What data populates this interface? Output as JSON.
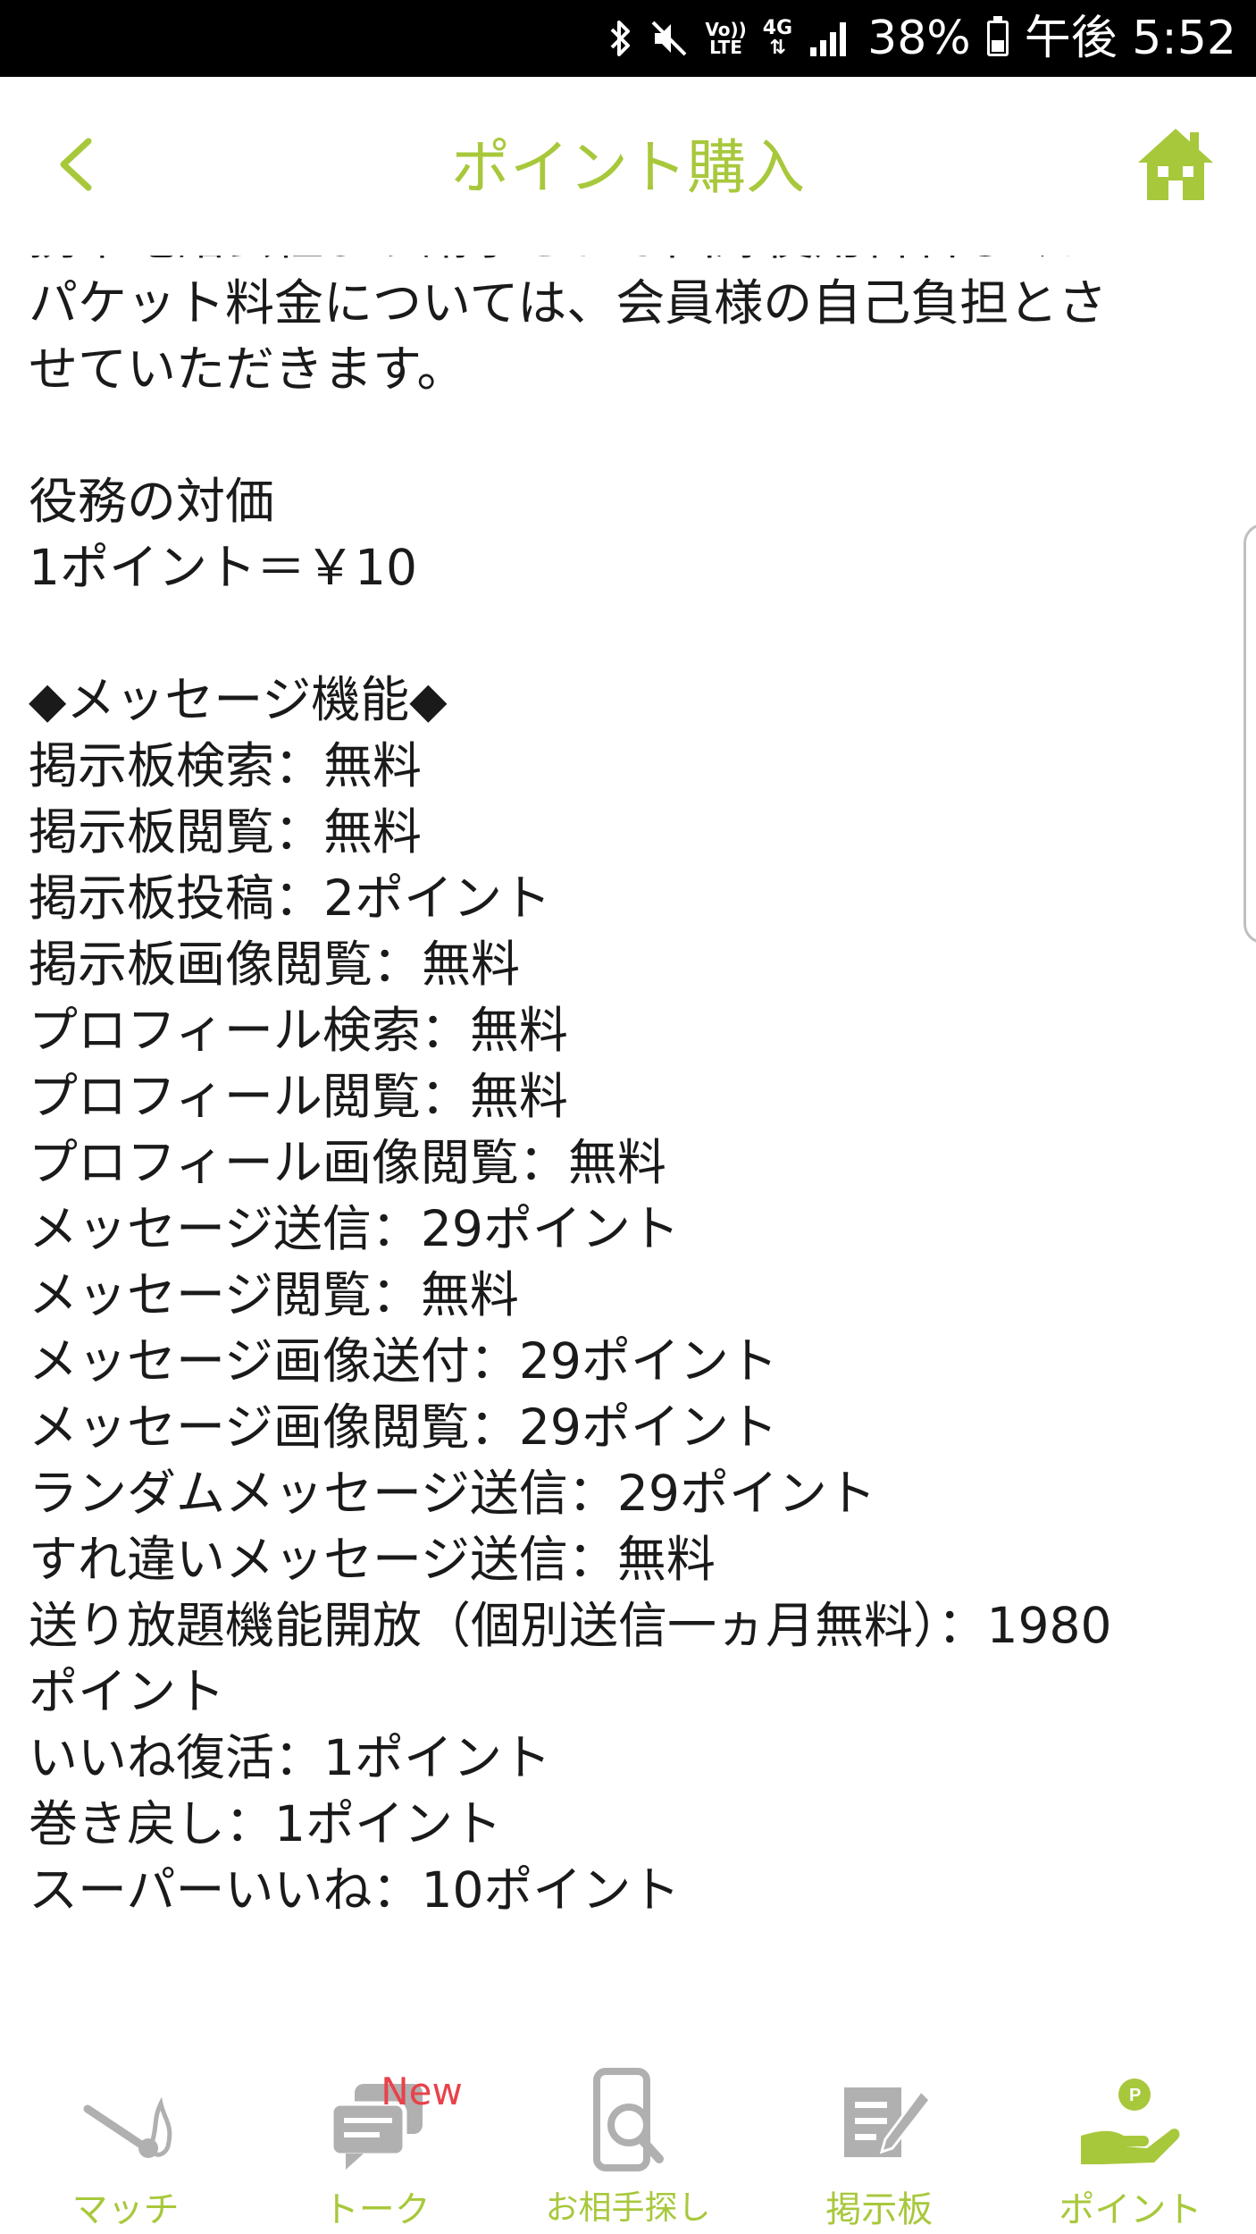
{
  "status_bar": {
    "battery_percent": "38%",
    "time": "午後 5:52",
    "network": "4G",
    "volte": [
      "Vo))",
      "LTE"
    ]
  },
  "header": {
    "title": "ポイント購入"
  },
  "content": {
    "cut_line": "携帯電話会社より請求される回線使用料若しくは",
    "intro_lines": [
      "パケット料金については、会員様の自己負担とさ",
      "せていただきます。"
    ],
    "price_heading": "役務の対価",
    "price_rate": "1ポイント＝￥10",
    "section_heading": "◆メッセージ機能◆",
    "items": [
      "掲示板検索：無料",
      "掲示板閲覧：無料",
      "掲示板投稿：2ポイント",
      "掲示板画像閲覧：無料",
      "プロフィール検索：無料",
      "プロフィール閲覧：無料",
      "プロフィール画像閲覧：無料",
      "メッセージ送信：29ポイント",
      "メッセージ閲覧：無料",
      "メッセージ画像送付：29ポイント",
      "メッセージ画像閲覧：29ポイント",
      "ランダムメッセージ送信：29ポイント",
      "すれ違いメッセージ送信：無料",
      "送り放題機能開放（個別送信一ヵ月無料）：1980",
      "ポイント",
      "いいね復活：1ポイント",
      "巻き戻し：1ポイント",
      "スーパーいいね：10ポイント"
    ]
  },
  "bottom_nav": {
    "items": [
      {
        "label": "マッチ",
        "icon": "match-icon"
      },
      {
        "label": "トーク",
        "icon": "talk-icon",
        "badge": "New"
      },
      {
        "label": "お相手探し",
        "icon": "search-partner-icon"
      },
      {
        "label": "掲示板",
        "icon": "bulletin-board-icon"
      },
      {
        "label": "ポイント",
        "icon": "point-icon",
        "active": true
      }
    ]
  },
  "colors": {
    "accent": "#a8c83c",
    "inactive_icon": "#b0b0b0",
    "badge": "#e8424a",
    "text": "#1a1a1a"
  }
}
